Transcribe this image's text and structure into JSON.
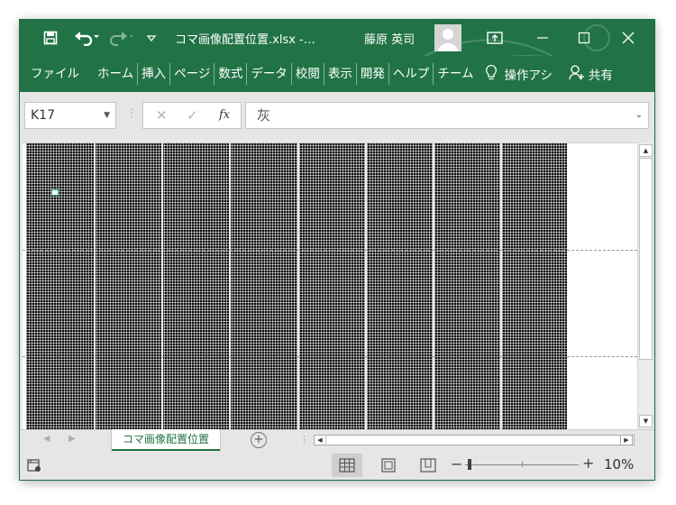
{
  "titlebar": {
    "document_title": "コマ画像配置位置.xlsx  -…",
    "user_name": "藤原 英司",
    "icons": {
      "save": "save-icon",
      "undo": "undo-icon",
      "redo": "redo-icon",
      "customize": "customize-qat-icon",
      "ribbon_options": "ribbon-display-options-icon",
      "minimize": "minimize-icon",
      "maximize": "maximize-icon",
      "close": "close-icon"
    },
    "color": "#217346"
  },
  "ribbon": {
    "tabs": [
      "ファイル",
      "ホーム",
      "挿入",
      "ページ",
      "数式",
      "データ",
      "校閲",
      "表示",
      "開発",
      "ヘルプ",
      "チーム"
    ],
    "tell_me": "操作アシ",
    "share": "共有"
  },
  "formula_bar": {
    "name_box": "K17",
    "fx_label": "fx",
    "value": "灰"
  },
  "sheet_tabs": {
    "active": "コマ画像配置位置"
  },
  "status_bar": {
    "zoom_level": "10%",
    "zoom_percent": 10
  }
}
